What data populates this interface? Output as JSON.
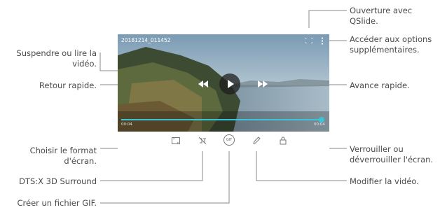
{
  "video": {
    "title": "20181214_011452",
    "time_elapsed": "00:04",
    "time_total": "00:04",
    "progress": 0.99,
    "accent_color": "#36c6d8"
  },
  "callouts": {
    "qslide": "Ouverture avec\nQSlide.",
    "more_options": "Accéder aux options\nsupplémentaires.",
    "pause_play": "Suspendre ou lire la\nvidéo.",
    "rewind": "Retour rapide.",
    "fast_forward": "Avance rapide.",
    "screen_ratio": "Choisir le format\nd'écran.",
    "lock_unlock": "Verrouiller ou\ndéverrouiller l'écran.",
    "dts": "DTS:X 3D Surround",
    "edit_video": "Modifier la vidéo.",
    "create_gif": "Créer un fichier GIF."
  },
  "toolbar": {
    "gif_label": "GIF"
  },
  "icons": {
    "qslide": "qslide-icon",
    "more": "more-options-icon",
    "play": "play-icon",
    "rewind": "rewind-icon",
    "forward": "fast-forward-icon",
    "ratio": "screen-ratio-icon",
    "dts": "dts-icon",
    "gif": "gif-icon",
    "edit": "edit-pencil-icon",
    "lock": "lock-icon"
  }
}
